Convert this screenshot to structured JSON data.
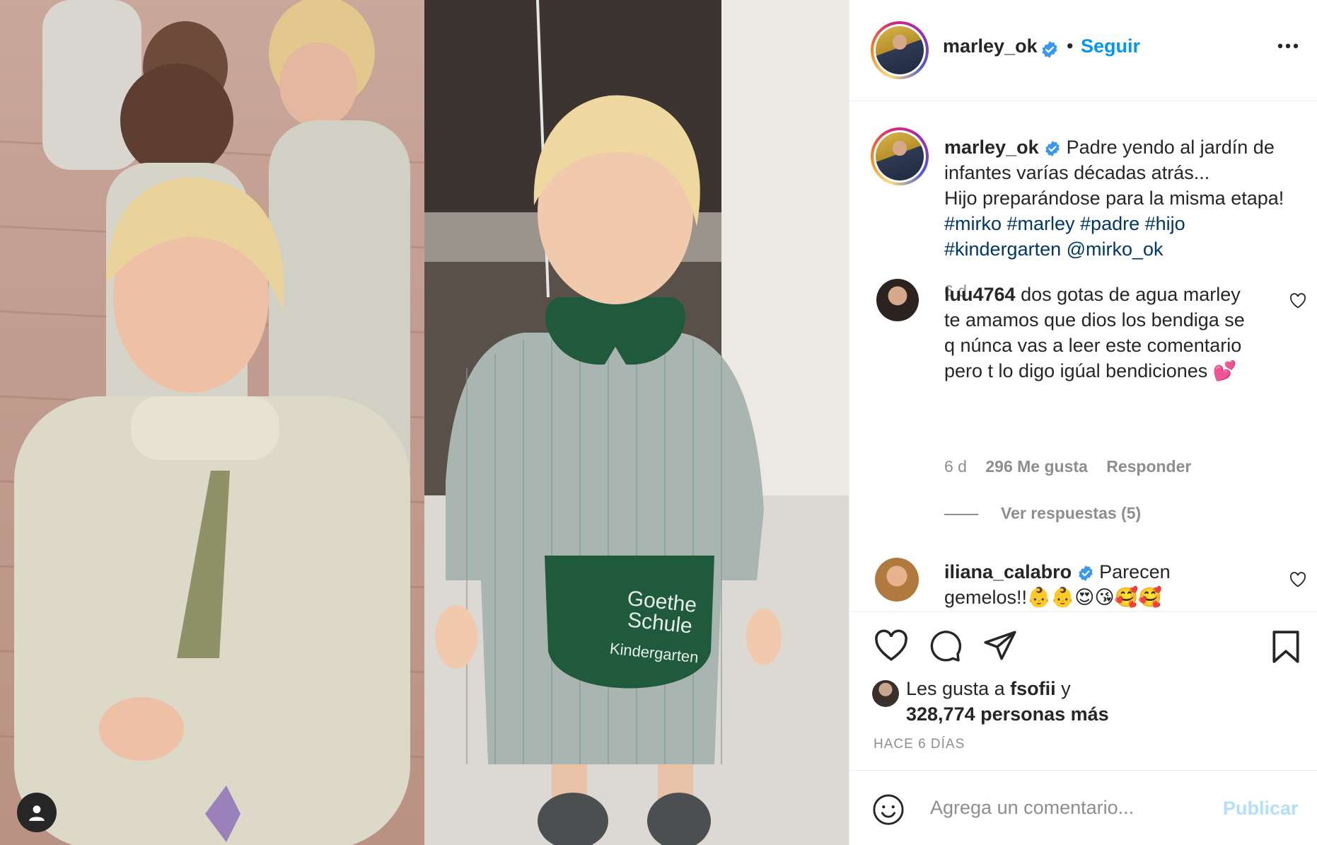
{
  "post": {
    "image_alt": "Padre yendo al jardín de infantes varías décadas atrás vs hijo con delantal Goethe Schule Kindergarten",
    "apron_line1": "Goethe",
    "apron_line2": "Schule",
    "apron_line3": "Kindergarten"
  },
  "header": {
    "username": "marley_ok",
    "separator": "•",
    "follow_label": "Seguir",
    "more_icon": "more-horizontal-icon"
  },
  "caption": {
    "username": "marley_ok",
    "line1": "Padre yendo al jardín de",
    "line2": "infantes varías décadas atrás...",
    "line3": "Hijo preparándose para la misma etapa!",
    "tags_line1": "#mirko #marley #padre #hijo",
    "tags_line2": "#kindergarten @mirko_ok",
    "time": "6 d"
  },
  "comments": [
    {
      "username": "luu4764",
      "text_line1": "dos gotas de agua marley",
      "text_line2": "te amamos que dios los bendiga se",
      "text_line3": "q núnca vas a leer este comentario",
      "text_line4": "pero t lo digo igúal bendiciones 💕",
      "time": "6 d",
      "likes": "296 Me gusta",
      "reply_label": "Responder",
      "view_replies": "Ver respuestas (5)"
    },
    {
      "username": "iliana_calabro",
      "text_line1": "Parecen",
      "text_line2": "gemelos!!👶👶😍😘🥰🥰"
    }
  ],
  "likes": {
    "prefix": "Les gusta a ",
    "liker": "fsofii",
    "suffix": " y",
    "count": "328,774 personas más"
  },
  "post_date": "HACE 6 DÍAS",
  "add_comment": {
    "placeholder": "Agrega un comentario...",
    "publish_label": "Publicar"
  },
  "colors": {
    "accent": "#0095f6",
    "link": "#00376b",
    "muted": "#8e8e8e",
    "publish_disabled": "#b2dffc",
    "verified": "#3897f0"
  }
}
